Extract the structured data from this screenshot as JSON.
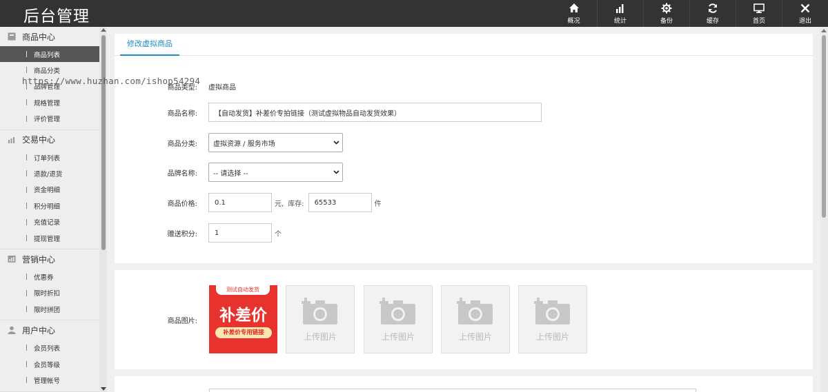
{
  "app": {
    "title": "后台管理"
  },
  "topnav": [
    {
      "label": "概况",
      "icon": "home-icon"
    },
    {
      "label": "统计",
      "icon": "bar-chart-icon"
    },
    {
      "label": "备份",
      "icon": "gear-icon"
    },
    {
      "label": "缓存",
      "icon": "refresh-icon"
    },
    {
      "label": "首页",
      "icon": "monitor-icon"
    },
    {
      "label": "退出",
      "icon": "close-icon"
    }
  ],
  "sidebar": {
    "groups": [
      {
        "title": "商品中心",
        "icon": "goods-icon",
        "items": [
          "商品列表",
          "商品分类",
          "品牌管理",
          "规格管理",
          "评价管理"
        ],
        "active": 0
      },
      {
        "title": "交易中心",
        "icon": "bar-chart-icon",
        "items": [
          "订单列表",
          "退款/退货",
          "资金明细",
          "积分明细",
          "充值记录",
          "提现管理"
        ]
      },
      {
        "title": "营销中心",
        "icon": "market-icon",
        "items": [
          "优惠券",
          "限时折扣",
          "限时拼团"
        ]
      },
      {
        "title": "用户中心",
        "icon": "user-icon",
        "items": [
          "会员列表",
          "会员等级",
          "管理帐号"
        ]
      }
    ]
  },
  "main": {
    "tab": "修改虚拟商品",
    "watermark": "https://www.huzhan.com/ishop54294",
    "form": {
      "type_label": "商品类型:",
      "type_value": "虚拟商品",
      "name_label": "商品名称:",
      "name_value": "【自动发货】补差价专拍链接（测试虚拟物品自动发货效果）",
      "category_label": "商品分类:",
      "category_value": "虚拟资源 / 服务市场",
      "brand_label": "品牌名称:",
      "brand_value": "-- 请选择 --",
      "price_label": "商品价格:",
      "price_value": "0.1",
      "price_unit": "元,",
      "stock_label": "库存:",
      "stock_value": "65533",
      "stock_unit": "件",
      "points_label": "赠送积分:",
      "points_value": "1",
      "points_unit": "个"
    },
    "images": {
      "label": "商品图片:",
      "product": {
        "banner": "测试自动发货",
        "big": "补差价",
        "pill": "补差价专用链接"
      },
      "upload_label": "上传图片",
      "upload_slots": 4
    }
  }
}
